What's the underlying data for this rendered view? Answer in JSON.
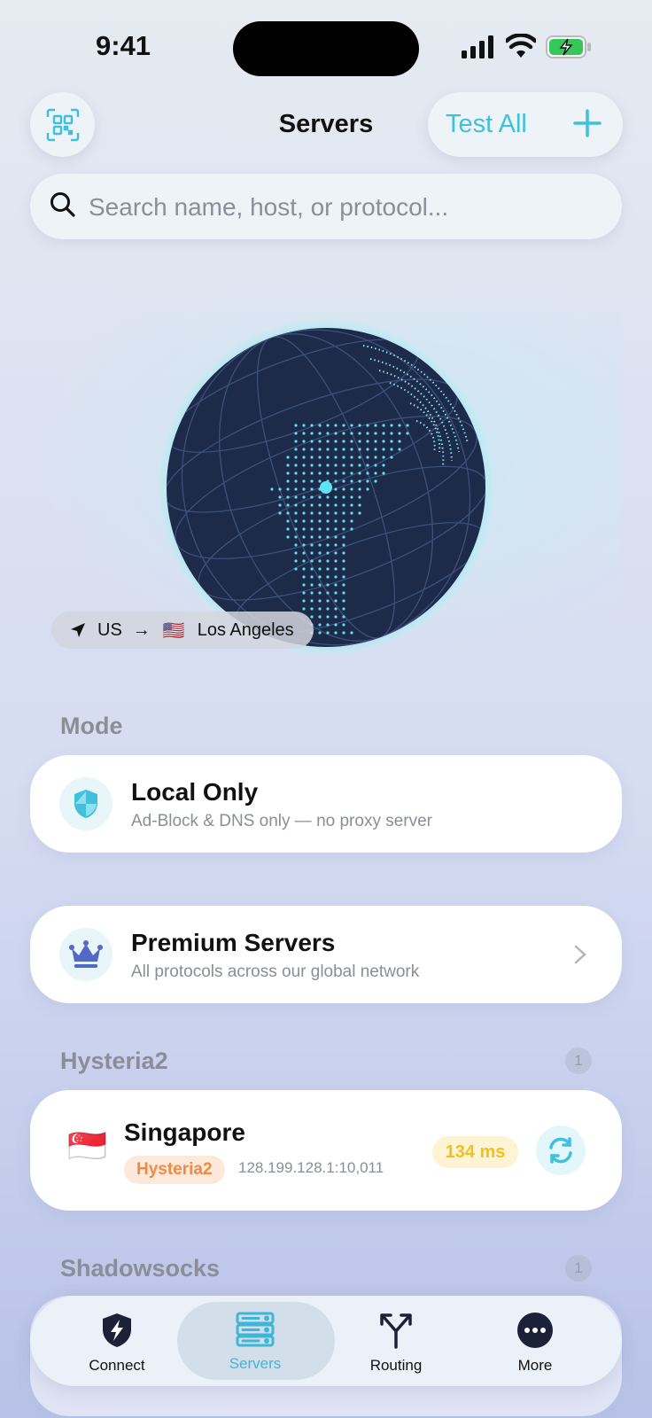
{
  "status_bar": {
    "time": "9:41"
  },
  "header": {
    "title": "Servers",
    "test_all_label": "Test All"
  },
  "search": {
    "placeholder": "Search name, host, or protocol..."
  },
  "location": {
    "from": "US",
    "arrow": "→",
    "flag": "🇺🇸",
    "city": "Los Angeles"
  },
  "mode": {
    "section_label": "Mode",
    "local": {
      "title": "Local Only",
      "subtitle": "Ad-Block & DNS only — no proxy server"
    },
    "premium": {
      "title": "Premium Servers",
      "subtitle": "All protocols across our global network"
    }
  },
  "groups": [
    {
      "label": "Hysteria2",
      "count": "1",
      "servers": [
        {
          "flag": "🇸🇬",
          "name": "Singapore",
          "protocol": "Hysteria2",
          "host": "128.199.128.1:10,011",
          "latency": "134 ms"
        }
      ]
    },
    {
      "label": "Shadowsocks",
      "count": "1"
    }
  ],
  "tabs": [
    {
      "label": "Connect",
      "icon": "bolt-shield-icon"
    },
    {
      "label": "Servers",
      "icon": "server-stack-icon",
      "active": true
    },
    {
      "label": "Routing",
      "icon": "fork-arrows-icon"
    },
    {
      "label": "More",
      "icon": "ellipsis-circle-icon"
    }
  ],
  "colors": {
    "accent": "#3fc1dd",
    "latency": "#f2c11e",
    "protocol_tag": "#ef8a44",
    "globe": "#1d2a4a"
  }
}
